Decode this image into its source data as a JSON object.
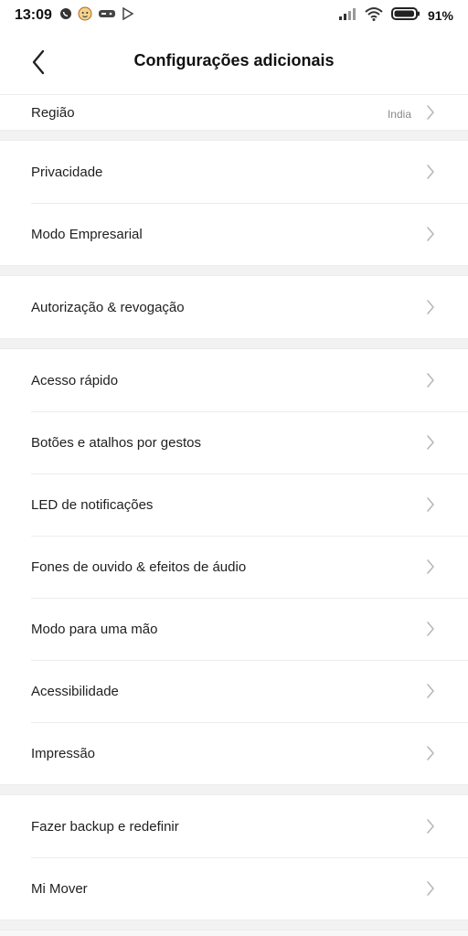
{
  "status_bar": {
    "time": "13:09",
    "battery": "91%",
    "icons_left": [
      "whatsapp-icon",
      "avatar-notification-icon",
      "game-icon",
      "play-store-icon"
    ],
    "icons_right": [
      "signal-icon",
      "wifi-icon",
      "battery-icon"
    ]
  },
  "header": {
    "title": "Configurações adicionais",
    "back_icon": "chevron-left-icon"
  },
  "groups": [
    {
      "items": [
        {
          "label": "Região",
          "value": "India",
          "partial": true
        }
      ]
    },
    {
      "items": [
        {
          "label": "Privacidade"
        },
        {
          "label": "Modo Empresarial"
        }
      ]
    },
    {
      "items": [
        {
          "label": "Autorização & revogação"
        }
      ]
    },
    {
      "items": [
        {
          "label": "Acesso rápido"
        },
        {
          "label": "Botões e atalhos por gestos"
        },
        {
          "label": "LED de notificações"
        },
        {
          "label": "Fones de ouvido & efeitos de áudio"
        },
        {
          "label": "Modo para uma mão"
        },
        {
          "label": "Acessibilidade"
        },
        {
          "label": "Impressão"
        }
      ]
    },
    {
      "items": [
        {
          "label": "Fazer backup e redefinir"
        },
        {
          "label": "Mi Mover"
        }
      ]
    }
  ],
  "colors": {
    "background": "#f7f7f7",
    "surface": "#ffffff",
    "divider": "#ececec",
    "text": "#1f1f1f",
    "secondary_text": "#8a8a8a",
    "chevron": "#b8b8b8"
  }
}
